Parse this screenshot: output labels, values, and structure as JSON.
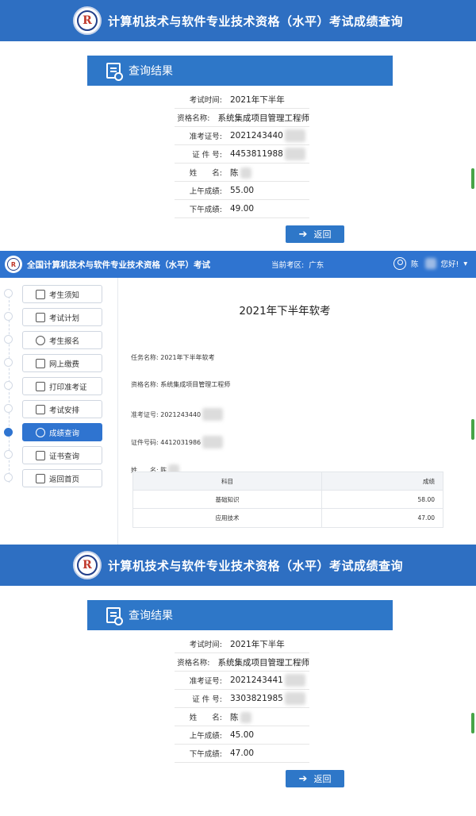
{
  "result1": {
    "header_title": "计算机技术与软件专业技术资格（水平）考试成绩查询",
    "panel_title": "查询结果",
    "rows": [
      {
        "label": "考试时间:",
        "value": "2021年下半年"
      },
      {
        "label": "资格名称:",
        "value": "系统集成项目管理工程师"
      },
      {
        "label": "准考证号:",
        "value": "2021243440"
      },
      {
        "label": "证 件 号:",
        "value": "4453811988"
      },
      {
        "label": "姓　　名:",
        "value": "陈"
      },
      {
        "label": "上午成绩:",
        "value": "55.00"
      },
      {
        "label": "下午成绩:",
        "value": "49.00"
      }
    ],
    "back_label": "返回"
  },
  "portal": {
    "title": "全国计算机技术与软件专业技术资格（水平）考试",
    "region_label": "当前考区:",
    "region_value": "广东",
    "user_name": "陈",
    "greeting": "您好!",
    "nav_items": [
      {
        "label": "考生须知",
        "icon": "notice-icon"
      },
      {
        "label": "考试计划",
        "icon": "calendar-icon"
      },
      {
        "label": "考生报名",
        "icon": "clock-icon"
      },
      {
        "label": "网上缴费",
        "icon": "monitor-icon"
      },
      {
        "label": "打印准考证",
        "icon": "printer-icon"
      },
      {
        "label": "考试安排",
        "icon": "document-icon"
      },
      {
        "label": "成绩查询",
        "icon": "search-icon",
        "active": true
      },
      {
        "label": "证书查询",
        "icon": "certificate-icon"
      },
      {
        "label": "返回首页",
        "icon": "home-icon"
      }
    ],
    "exam_title": "2021年下半年软考",
    "fields": [
      {
        "label": "任务名称:",
        "value": "2021年下半年软考"
      },
      {
        "label": "资格名称:",
        "value": "系统集成项目管理工程师"
      },
      {
        "label": "准考证号:",
        "value": "2021243440"
      },
      {
        "label": "证件号码:",
        "value": "4412031986"
      },
      {
        "label": "姓　　名:",
        "value": "陈"
      }
    ],
    "table": {
      "headers": [
        "科目",
        "成绩"
      ],
      "rows": [
        {
          "subject": "基础知识",
          "score": "58.00"
        },
        {
          "subject": "应用技术",
          "score": "47.00"
        }
      ]
    }
  },
  "result2": {
    "header_title": "计算机技术与软件专业技术资格（水平）考试成绩查询",
    "panel_title": "查询结果",
    "rows": [
      {
        "label": "考试时间:",
        "value": "2021年下半年"
      },
      {
        "label": "资格名称:",
        "value": "系统集成项目管理工程师"
      },
      {
        "label": "准考证号:",
        "value": "2021243441"
      },
      {
        "label": "证 件 号:",
        "value": "3303821985"
      },
      {
        "label": "姓　　名:",
        "value": "陈"
      },
      {
        "label": "上午成绩:",
        "value": "45.00"
      },
      {
        "label": "下午成绩:",
        "value": "47.00"
      }
    ],
    "back_label": "返回"
  },
  "seal_letter": "R",
  "colors": {
    "header_blue": "#2e6fc2",
    "panel_blue": "#2e77c8",
    "portal_blue": "#2f74d0"
  }
}
